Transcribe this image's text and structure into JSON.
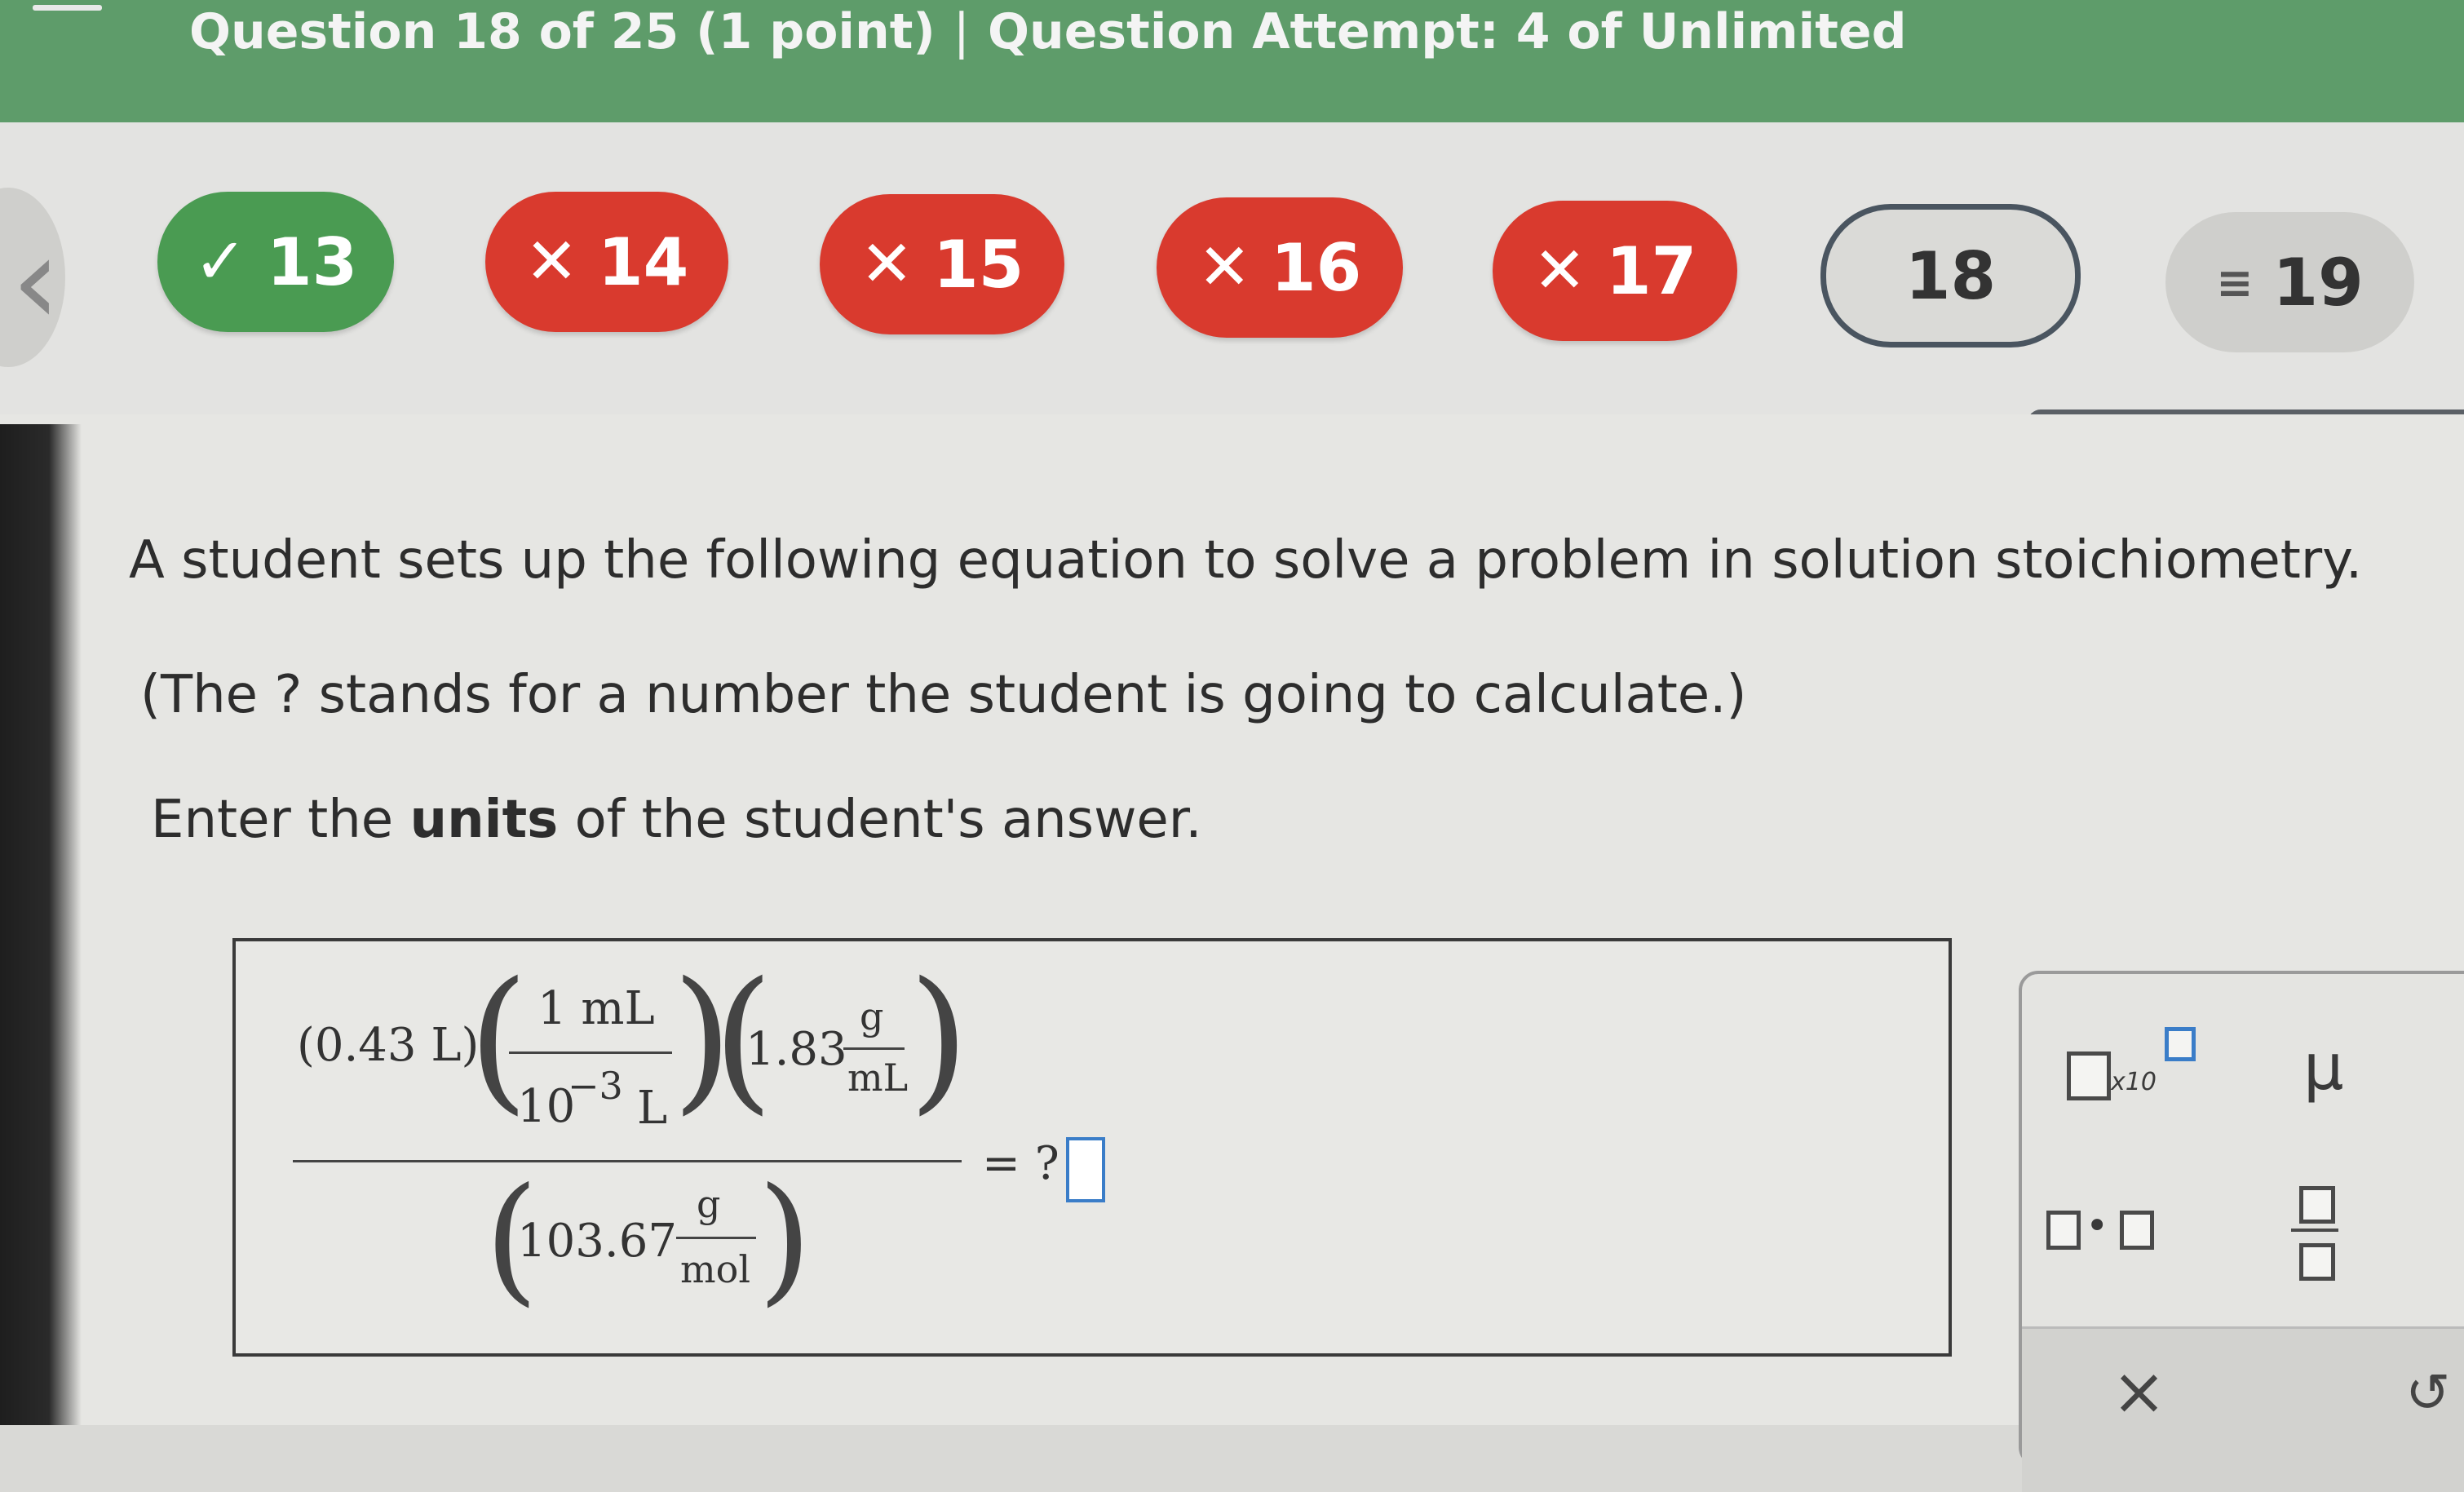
{
  "header": {
    "question_label": "Question 18 of 25 (1 point)",
    "separator": "|",
    "attempt_label": "Question Attempt: 4 of Unlimited"
  },
  "nav": {
    "questions": [
      {
        "number": "13",
        "status": "correct",
        "mark": "✓"
      },
      {
        "number": "14",
        "status": "incorrect",
        "mark": "✕"
      },
      {
        "number": "15",
        "status": "incorrect",
        "mark": "✕"
      },
      {
        "number": "16",
        "status": "incorrect",
        "mark": "✕"
      },
      {
        "number": "17",
        "status": "incorrect",
        "mark": "✕"
      },
      {
        "number": "18",
        "status": "current",
        "mark": ""
      },
      {
        "number": "19",
        "status": "unanswered",
        "mark": "≡"
      }
    ]
  },
  "problem": {
    "line1": "A student sets up the following equation to solve a problem in solution stoichiometry.",
    "line2": "(The ? stands for a number the student is going to calculate.)",
    "line3_pre": "Enter the ",
    "line3_bold": "units",
    "line3_post": " of the student's answer."
  },
  "equation": {
    "term1": "(0.43 L)",
    "frac1_num": "1 mL",
    "frac1_den_base": "10",
    "frac1_den_exp": "−3",
    "frac1_den_unit": "L",
    "term2_value": "1.83",
    "frac2_num": "g",
    "frac2_den": "mL",
    "denom_value": "103.67",
    "frac3_num": "g",
    "frac3_den": "mol",
    "equals": "= ?"
  },
  "palette": {
    "x10_label": "x10",
    "mu_label": "μ",
    "close_symbol": "×",
    "undo_symbol": "↺"
  },
  "colors": {
    "header_green": "#5e9c6a",
    "correct_green": "#4a9b52",
    "incorrect_red": "#d93a2e",
    "current_border": "#4a5560"
  }
}
